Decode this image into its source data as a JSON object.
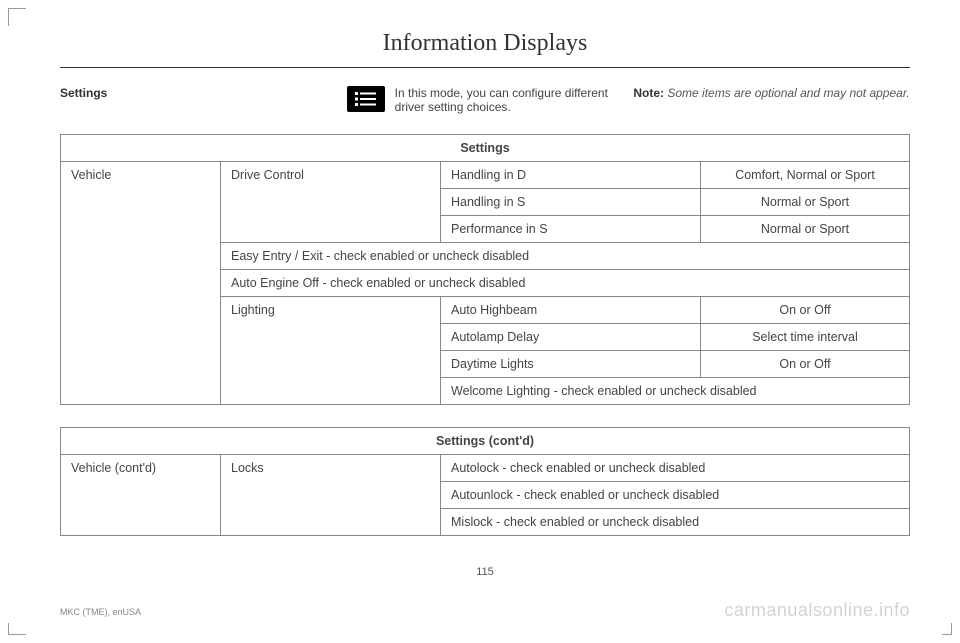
{
  "page_title": "Information Displays",
  "intro": {
    "subhead": "Settings",
    "description": "In this mode, you can configure different driver setting choices.",
    "note_label": "Note:",
    "note_text": " Some items are optional and may not appear."
  },
  "table1": {
    "caption": "Settings",
    "c1_header": "Vehicle",
    "group1": {
      "label": "Drive Control",
      "rows": [
        {
          "item": "Handling in D",
          "opt": "Comfort, Normal or Sport"
        },
        {
          "item": "Handling in S",
          "opt": "Normal or Sport"
        },
        {
          "item": "Performance in S",
          "opt": "Normal or Sport"
        }
      ]
    },
    "span_rows": [
      "Easy Entry / Exit - check enabled or uncheck disabled",
      "Auto Engine Off - check enabled or uncheck disabled"
    ],
    "group2": {
      "label": "Lighting",
      "rows": [
        {
          "item": "Auto Highbeam",
          "opt": "On or Off"
        },
        {
          "item": "Autolamp Delay",
          "opt": "Select time interval"
        },
        {
          "item": "Daytime Lights",
          "opt": "On or Off"
        }
      ],
      "span_row": "Welcome Lighting - check enabled or uncheck disabled"
    }
  },
  "table2": {
    "caption": "Settings (cont'd)",
    "c1_header": "Vehicle (cont'd)",
    "group": {
      "label": "Locks",
      "rows": [
        "Autolock - check enabled or uncheck disabled",
        "Autounlock - check enabled or uncheck disabled",
        "Mislock - check enabled or uncheck disabled"
      ]
    }
  },
  "page_number": "115",
  "footer_left": "MKC (TME), enUSA",
  "watermark": "carmanualsonline.info"
}
